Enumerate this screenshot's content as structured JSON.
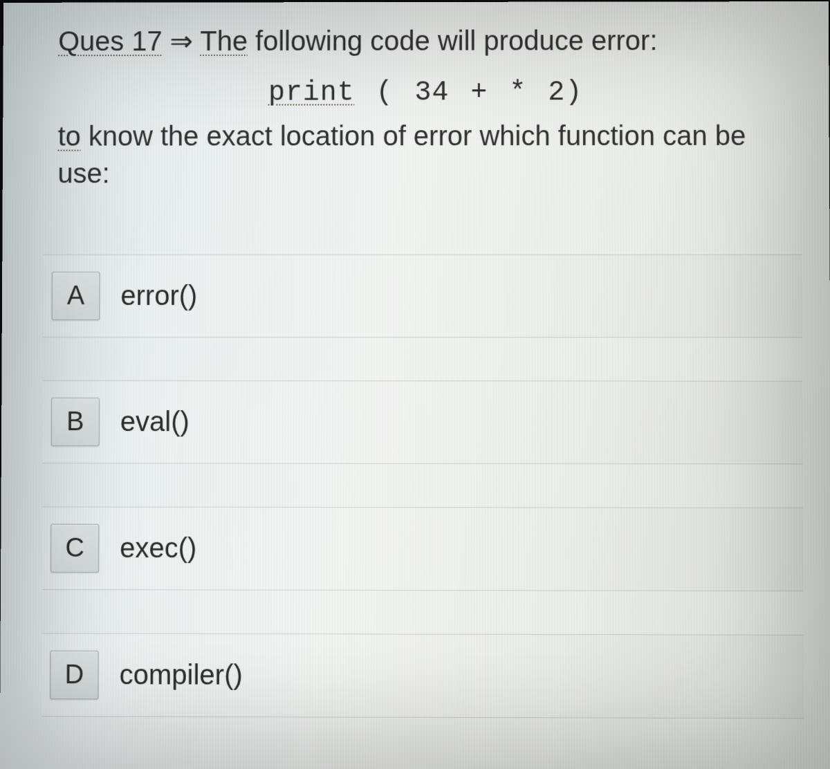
{
  "question": {
    "prefix": "Ques 17",
    "arrow": " ⇒ ",
    "line1_a": "The",
    "line1_b": " following code will produce error:",
    "code_print": "print",
    "code_rest": " ( 34 +  * 2)",
    "line2_a": "to",
    "line2_b": " know the exact location of error which function can be  use:"
  },
  "options": [
    {
      "letter": "A",
      "text": "error()"
    },
    {
      "letter": "B",
      "text": "eval()"
    },
    {
      "letter": "C",
      "text": "exec()"
    },
    {
      "letter": "D",
      "text": "compiler()"
    }
  ]
}
